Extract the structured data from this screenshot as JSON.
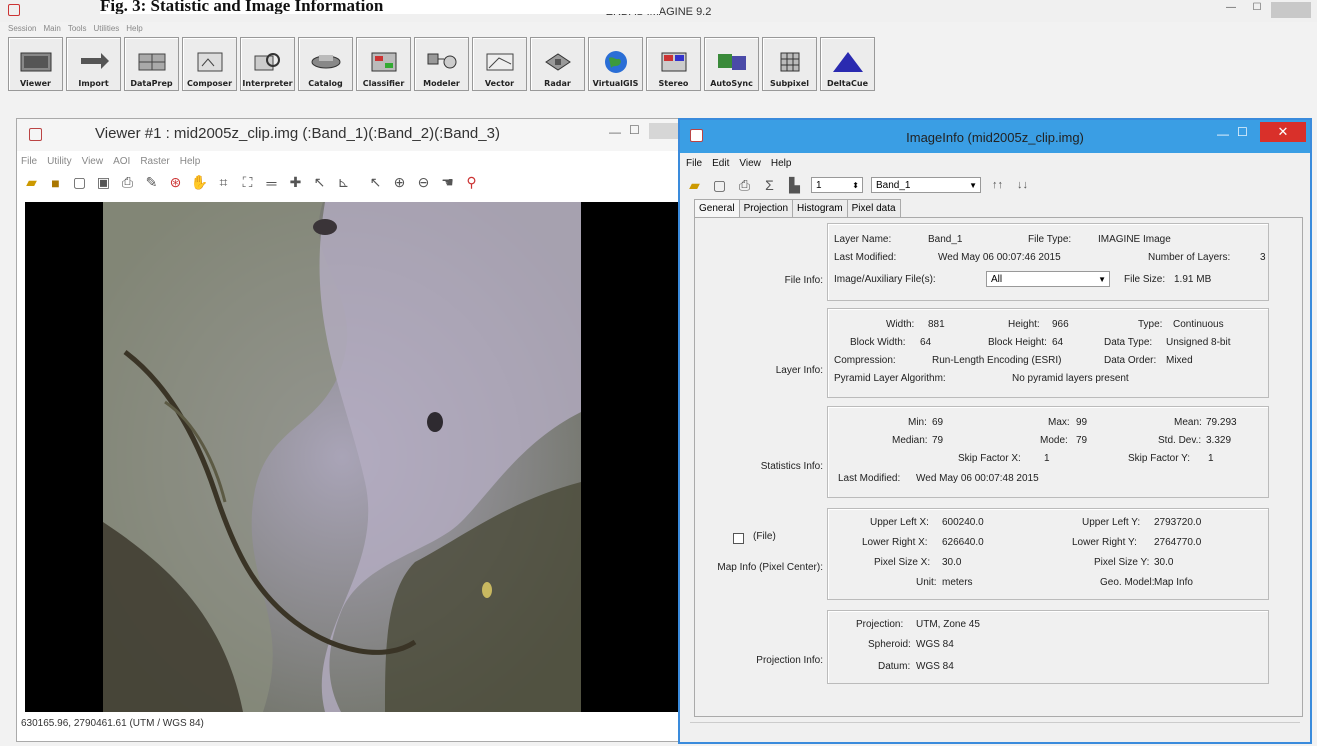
{
  "caption": "Fig. 3: Statistic and Image Information",
  "app": {
    "title": "ERDAS IMAGINE 9.2",
    "menu": [
      "Session",
      "Main",
      "Tools",
      "Utilities",
      "Help"
    ],
    "toolbar": [
      {
        "label": "Viewer",
        "icon": "viewer-icon"
      },
      {
        "label": "Import",
        "icon": "import-icon"
      },
      {
        "label": "DataPrep",
        "icon": "dataprep-icon"
      },
      {
        "label": "Composer",
        "icon": "composer-icon"
      },
      {
        "label": "Interpreter",
        "icon": "interpreter-icon"
      },
      {
        "label": "Catalog",
        "icon": "catalog-icon"
      },
      {
        "label": "Classifier",
        "icon": "classifier-icon"
      },
      {
        "label": "Modeler",
        "icon": "modeler-icon"
      },
      {
        "label": "Vector",
        "icon": "vector-icon"
      },
      {
        "label": "Radar",
        "icon": "radar-icon"
      },
      {
        "label": "VirtualGIS",
        "icon": "globe-icon"
      },
      {
        "label": "Stereo",
        "icon": "stereo-icon"
      },
      {
        "label": "AutoSync",
        "icon": "autosync-icon"
      },
      {
        "label": "Subpixel",
        "icon": "subpixel-icon"
      },
      {
        "label": "DeltaCue",
        "icon": "deltacue-icon"
      }
    ]
  },
  "viewer": {
    "title": "Viewer #1 : mid2005z_clip.img (:Band_1)(:Band_2)(:Band_3)",
    "menu": [
      "File",
      "Utility",
      "View",
      "AOI",
      "Raster",
      "Help"
    ],
    "status": "630165.96, 2790461.61  (UTM / WGS 84)"
  },
  "info": {
    "title": "ImageInfo (mid2005z_clip.img)",
    "menu": [
      "File",
      "Edit",
      "View",
      "Help"
    ],
    "layer_number": "1",
    "band": "Band_1",
    "tabs": [
      "General",
      "Projection",
      "Histogram",
      "Pixel data"
    ],
    "file_info": {
      "label": "File Info:",
      "layer_name_label": "Layer Name:",
      "layer_name": "Band_1",
      "file_type_label": "File Type:",
      "file_type": "IMAGINE Image",
      "last_modified_label": "Last Modified:",
      "last_modified": "Wed May 06 00:07:46 2015",
      "num_layers_label": "Number of Layers:",
      "num_layers": "3",
      "aux_label": "Image/Auxiliary File(s):",
      "aux": "All",
      "file_size_label": "File Size:",
      "file_size": "1.91 MB"
    },
    "layer_info": {
      "label": "Layer Info:",
      "width_label": "Width:",
      "width": "881",
      "height_label": "Height:",
      "height": "966",
      "type_label": "Type:",
      "type": "Continuous",
      "bw_label": "Block Width:",
      "bw": "64",
      "bh_label": "Block Height:",
      "bh": "64",
      "dt_label": "Data Type:",
      "dt": "Unsigned 8-bit",
      "comp_label": "Compression:",
      "comp": "Run-Length Encoding (ESRI)",
      "order_label": "Data Order:",
      "order": "Mixed",
      "pyr_label": "Pyramid Layer Algorithm:",
      "pyr": "No pyramid layers present"
    },
    "stats": {
      "label": "Statistics Info:",
      "min_label": "Min:",
      "min": "69",
      "max_label": "Max:",
      "max": "99",
      "mean_label": "Mean:",
      "mean": "79.293",
      "median_label": "Median:",
      "median": "79",
      "mode_label": "Mode:",
      "mode": "79",
      "std_label": "Std. Dev.:",
      "std": "3.329",
      "skipx_label": "Skip Factor X:",
      "skipx": "1",
      "skipy_label": "Skip Factor Y:",
      "skipy": "1",
      "lm_label": "Last Modified:",
      "lm": "Wed May 06 00:07:48 2015"
    },
    "map": {
      "file_check": "(File)",
      "label": "Map Info (Pixel Center):",
      "ulx_label": "Upper Left X:",
      "ulx": "600240.0",
      "uly_label": "Upper Left Y:",
      "uly": "2793720.0",
      "lrx_label": "Lower Right X:",
      "lrx": "626640.0",
      "lry_label": "Lower Right Y:",
      "lry": "2764770.0",
      "psx_label": "Pixel Size X:",
      "psx": "30.0",
      "psy_label": "Pixel Size Y:",
      "psy": "30.0",
      "unit_label": "Unit:",
      "unit": "meters",
      "geo_label": "Geo. Model:",
      "geo": "Map Info"
    },
    "proj": {
      "label": "Projection Info:",
      "proj_label": "Projection:",
      "proj": "UTM, Zone 45",
      "sph_label": "Spheroid:",
      "sph": "WGS 84",
      "datum_label": "Datum:",
      "datum": "WGS 84"
    }
  }
}
